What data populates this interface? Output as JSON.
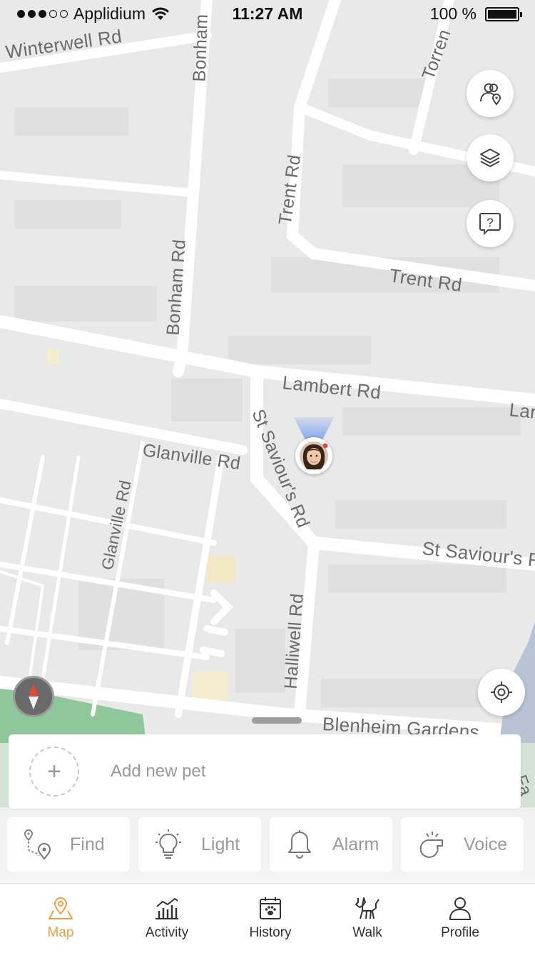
{
  "status_bar": {
    "carrier": "Applidium",
    "time": "11:27 AM",
    "battery": "100 %"
  },
  "map": {
    "roads": [
      {
        "label": "Winterwell Rd"
      },
      {
        "label": "Bonham"
      },
      {
        "label": "Torren"
      },
      {
        "label": "Trent Rd"
      },
      {
        "label": "Trent Rd"
      },
      {
        "label": "Bonham Rd"
      },
      {
        "label": "Lambert Rd"
      },
      {
        "label": "Lar"
      },
      {
        "label": "Glanville Rd"
      },
      {
        "label": "St Saviour's Rd"
      },
      {
        "label": "Glanville Rd"
      },
      {
        "label": "St Saviour's R"
      },
      {
        "label": "Halliwell Rd"
      },
      {
        "label": "Blenheim Gardens"
      },
      {
        "label": "Fa"
      }
    ]
  },
  "map_buttons": {
    "people_icon": "people-location-icon",
    "layers_icon": "layers-icon",
    "help_icon": "help-chat-icon",
    "locate_icon": "crosshair-icon",
    "compass_icon": "compass-icon"
  },
  "add_pet": {
    "plus": "+",
    "label": "Add new pet"
  },
  "actions": [
    {
      "label": "Find",
      "icon": "route-pin-icon"
    },
    {
      "label": "Light",
      "icon": "bulb-icon"
    },
    {
      "label": "Alarm",
      "icon": "bell-icon"
    },
    {
      "label": "Voice",
      "icon": "whistle-icon"
    }
  ],
  "tabs": [
    {
      "label": "Map",
      "icon": "map-pin-icon",
      "active": true
    },
    {
      "label": "Activity",
      "icon": "chart-icon",
      "active": false
    },
    {
      "label": "History",
      "icon": "calendar-paw-icon",
      "active": false
    },
    {
      "label": "Walk",
      "icon": "dog-icon",
      "active": false
    },
    {
      "label": "Profile",
      "icon": "person-icon",
      "active": false
    }
  ],
  "colors": {
    "accent": "#f0a040",
    "map_bg": "#e9e9e9",
    "road": "#ffffff",
    "park": "#8fc79b"
  }
}
